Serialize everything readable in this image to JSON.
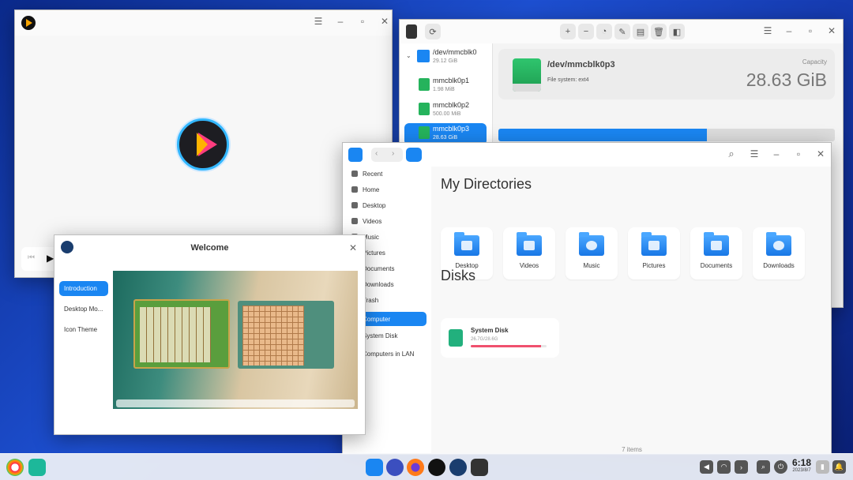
{
  "player": {
    "icons": [
      "app-icon",
      "menu-icon",
      "minimize-icon",
      "maximize-icon",
      "close-icon",
      "play-icon",
      "prev-icon"
    ]
  },
  "disk": {
    "devices": [
      {
        "name": "/dev/mmcblk0",
        "size": "29.12 GiB"
      },
      {
        "name": "mmcblk0p1",
        "size": "1.98 MiB"
      },
      {
        "name": "mmcblk0p2",
        "size": "500.00 MiB"
      },
      {
        "name": "mmcblk0p3",
        "size": "28.63 GiB"
      }
    ],
    "selected_partition": "/dev/mmcblk0p3",
    "filesystem": "File system: ext4",
    "capacity_label": "Capacity",
    "capacity_value": "28.63 GiB",
    "usage_fraction": 0.62,
    "toolbar_icons": [
      "add-icon",
      "remove-icon",
      "pie-icon",
      "erase-icon",
      "format-icon",
      "delete-icon",
      "info-icon"
    ]
  },
  "files": {
    "sidebar": [
      {
        "label": "Recent"
      },
      {
        "label": "Home"
      },
      {
        "label": "Desktop"
      },
      {
        "label": "Videos"
      },
      {
        "label": "Music"
      },
      {
        "label": "Pictures"
      },
      {
        "label": "Documents"
      },
      {
        "label": "Downloads"
      },
      {
        "label": "Trash"
      },
      {
        "label": "Computer"
      },
      {
        "label": "System Disk"
      },
      {
        "label": "Computers in LAN"
      }
    ],
    "my_directories_title": "My Directories",
    "directories": [
      {
        "label": "Desktop"
      },
      {
        "label": "Videos"
      },
      {
        "label": "Music"
      },
      {
        "label": "Pictures"
      },
      {
        "label": "Documents"
      },
      {
        "label": "Downloads"
      }
    ],
    "disks_title": "Disks",
    "disk": {
      "name": "System Disk",
      "usage": "26.7G/28.6G",
      "fraction": 0.93
    },
    "item_count": "7 items"
  },
  "welcome": {
    "title": "Welcome",
    "nav": [
      {
        "label": "Introduction"
      },
      {
        "label": "Desktop Mo..."
      },
      {
        "label": "Icon Theme"
      }
    ]
  },
  "taskbar": {
    "time": "6:18",
    "date": "2023/8/7"
  },
  "colors": {
    "accent": "#1a86f2",
    "disk_usage": "#f0506e",
    "drive_green": "#25b35c"
  }
}
